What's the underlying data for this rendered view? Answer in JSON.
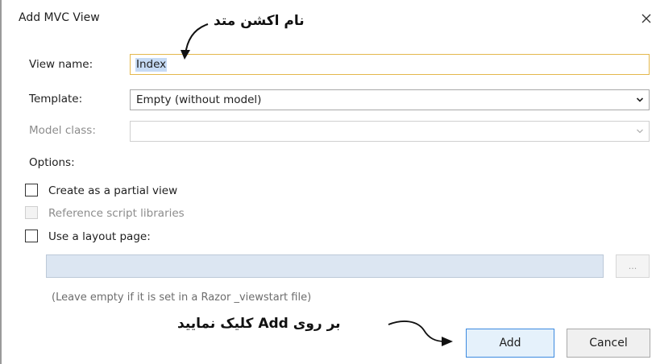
{
  "dialog": {
    "title": "Add MVC View"
  },
  "form": {
    "view_name_label": "View name:",
    "view_name_value": "Index",
    "template_label": "Template:",
    "template_value": "Empty (without model)",
    "model_class_label": "Model class:",
    "model_class_value": ""
  },
  "options": {
    "heading": "Options:",
    "items": [
      {
        "label": "Create as a partial view",
        "checked": false,
        "enabled": true
      },
      {
        "label": "Reference script libraries",
        "checked": false,
        "enabled": false
      },
      {
        "label": "Use a layout page:",
        "checked": false,
        "enabled": true
      }
    ],
    "layout_page_value": "",
    "browse_label": "...",
    "hint": "(Leave empty if it is set in a Razor _viewstart file)"
  },
  "buttons": {
    "add_label": "Add",
    "cancel_label": "Cancel"
  },
  "annotations": {
    "action_method_name": "نام اکشن متد",
    "click_add": "بر روی Add کلیک نمایید"
  },
  "colors": {
    "focus_border": "#e4b84d",
    "selection": "#c6dbf5",
    "primary_border": "#3c8ae0",
    "layout_input_bg": "#dce6f2"
  },
  "icons": {
    "close": "close-icon",
    "dropdown": "chevron-down-icon"
  }
}
